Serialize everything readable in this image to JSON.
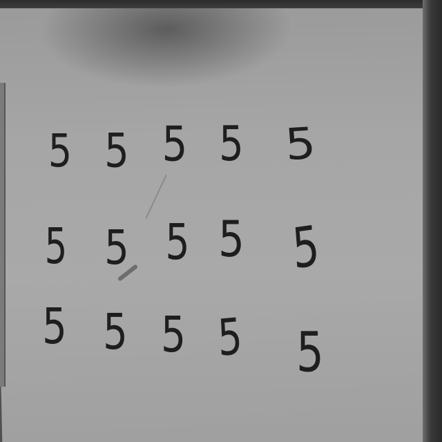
{
  "digits": {
    "row1": [
      "5",
      "5",
      "5",
      "5",
      "5"
    ],
    "row2": [
      "5",
      "5",
      "5",
      "5",
      "5"
    ],
    "row3": [
      "5",
      "5",
      "5",
      "5",
      "5"
    ]
  },
  "colors": {
    "ink": "#1e1e1e",
    "paper": "#a6a6a6",
    "background": "#4a4a4a"
  }
}
